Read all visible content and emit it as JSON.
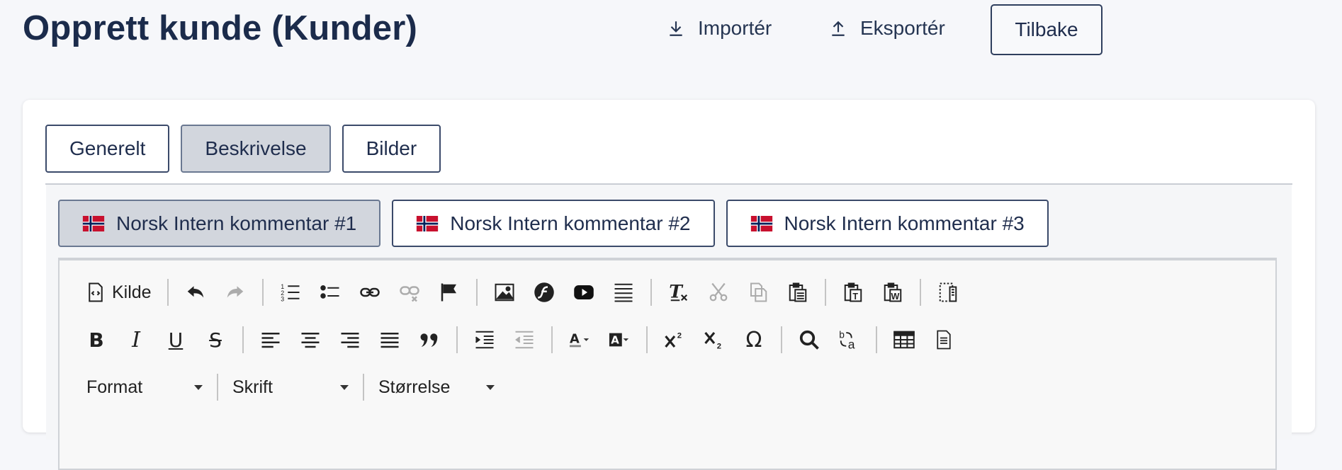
{
  "header": {
    "title": "Opprett kunde (Kunder)",
    "import_label": "Importér",
    "export_label": "Eksportér",
    "back_label": "Tilbake"
  },
  "tabs": [
    {
      "label": "Generelt",
      "active": false
    },
    {
      "label": "Beskrivelse",
      "active": true
    },
    {
      "label": "Bilder",
      "active": false
    }
  ],
  "language_tabs": [
    {
      "label": "Norsk Intern kommentar #1",
      "flag": "norway-flag-icon",
      "active": true
    },
    {
      "label": "Norsk Intern kommentar #2",
      "flag": "norway-flag-icon",
      "active": false
    },
    {
      "label": "Norsk Intern kommentar #3",
      "flag": "norway-flag-icon",
      "active": false
    }
  ],
  "editor": {
    "source_label": "Kilde",
    "format_label": "Format",
    "font_label": "Skrift",
    "size_label": "Størrelse",
    "toolbar_row1": [
      "source-icon",
      "undo-icon",
      "redo-icon",
      "numbered-list-icon",
      "bulleted-list-icon",
      "link-icon",
      "unlink-icon",
      "anchor-flag-icon",
      "image-icon",
      "flash-icon",
      "youtube-icon",
      "horizontal-line-icon",
      "remove-format-icon",
      "cut-icon",
      "copy-icon",
      "paste-icon",
      "paste-text-icon",
      "paste-word-icon",
      "templates-icon"
    ],
    "toolbar_row2": [
      "bold-icon",
      "italic-icon",
      "underline-icon",
      "strikethrough-icon",
      "align-left-icon",
      "align-center-icon",
      "align-right-icon",
      "justify-icon",
      "blockquote-icon",
      "indent-icon",
      "outdent-icon",
      "text-color-icon",
      "background-color-icon",
      "superscript-icon",
      "subscript-icon",
      "special-char-icon",
      "find-icon",
      "replace-icon",
      "table-icon",
      "page-icon"
    ]
  },
  "colors": {
    "title": "#1b2b4b",
    "active_tab_bg": "#d2d6dd",
    "border": "#3b4a6a",
    "flag_red": "#c8102e",
    "flag_blue": "#00205b"
  }
}
